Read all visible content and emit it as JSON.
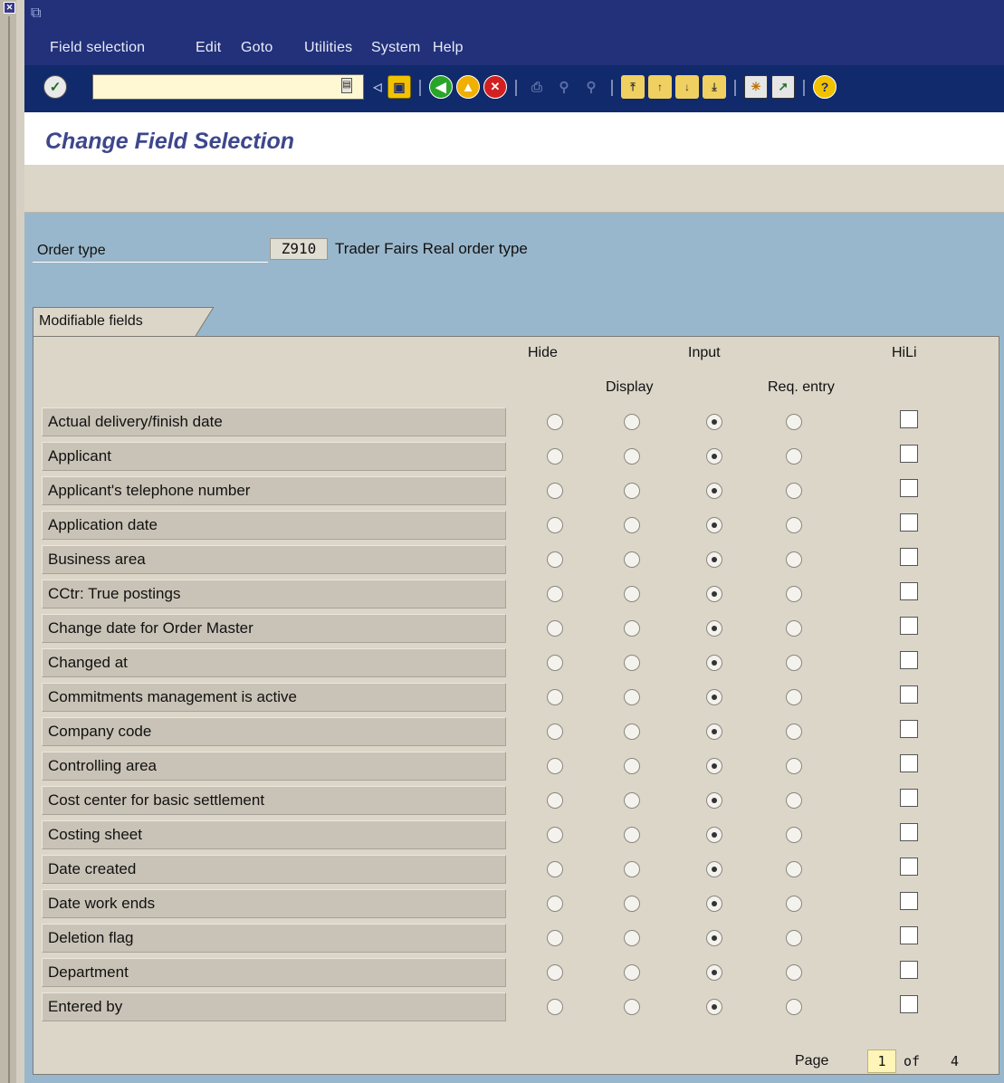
{
  "menu": {
    "items": [
      {
        "label": "Field selection"
      },
      {
        "label": "Edit"
      },
      {
        "label": "Goto"
      },
      {
        "label": "Utilities"
      },
      {
        "label": "System"
      },
      {
        "label": "Help"
      }
    ]
  },
  "screen": {
    "title": "Change Field Selection"
  },
  "order_type": {
    "label": "Order type",
    "code": "Z910",
    "description": "Trader Fairs Real order type"
  },
  "panel": {
    "tab_label": "Modifiable fields",
    "columns": {
      "hide": "Hide",
      "input": "Input",
      "hili": "HiLi",
      "display": "Display",
      "req_entry": "Req. entry"
    }
  },
  "fields": [
    {
      "label": "Actual delivery/finish date",
      "selection": "Input",
      "hili": false
    },
    {
      "label": "Applicant",
      "selection": "Input",
      "hili": false
    },
    {
      "label": "Applicant's telephone number",
      "selection": "Input",
      "hili": false
    },
    {
      "label": "Application date",
      "selection": "Input",
      "hili": false
    },
    {
      "label": "Business area",
      "selection": "Input",
      "hili": false
    },
    {
      "label": "CCtr: True postings",
      "selection": "Input",
      "hili": false
    },
    {
      "label": "Change date for Order Master",
      "selection": "Input",
      "hili": false
    },
    {
      "label": "Changed at",
      "selection": "Input",
      "hili": false
    },
    {
      "label": "Commitments management is active",
      "selection": "Input",
      "hili": false
    },
    {
      "label": "Company code",
      "selection": "Input",
      "hili": false
    },
    {
      "label": "Controlling area",
      "selection": "Input",
      "hili": false
    },
    {
      "label": "Cost center for basic settlement",
      "selection": "Input",
      "hili": false
    },
    {
      "label": "Costing sheet",
      "selection": "Input",
      "hili": false
    },
    {
      "label": "Date created",
      "selection": "Input",
      "hili": false
    },
    {
      "label": "Date work ends",
      "selection": "Input",
      "hili": false
    },
    {
      "label": "Deletion flag",
      "selection": "Input",
      "hili": false
    },
    {
      "label": "Department",
      "selection": "Input",
      "hili": false
    },
    {
      "label": "Entered by",
      "selection": "Input",
      "hili": false
    }
  ],
  "pager": {
    "label": "Page",
    "current": "1",
    "of_label": "of",
    "total": "4"
  },
  "colors": {
    "menubar": "#22317a",
    "toolbar": "#102a6b",
    "content": "#99b7cc",
    "panel": "#dcd6c9",
    "title": "#3d478c"
  },
  "toolbar_icons": [
    "enter-icon",
    "command-field",
    "save-icon",
    "back-icon",
    "exit-icon",
    "cancel-icon",
    "print-icon",
    "find-icon",
    "find-next-icon",
    "first-page-icon",
    "previous-page-icon",
    "next-page-icon",
    "last-page-icon",
    "new-session-icon",
    "shortcut-icon",
    "help-icon"
  ]
}
